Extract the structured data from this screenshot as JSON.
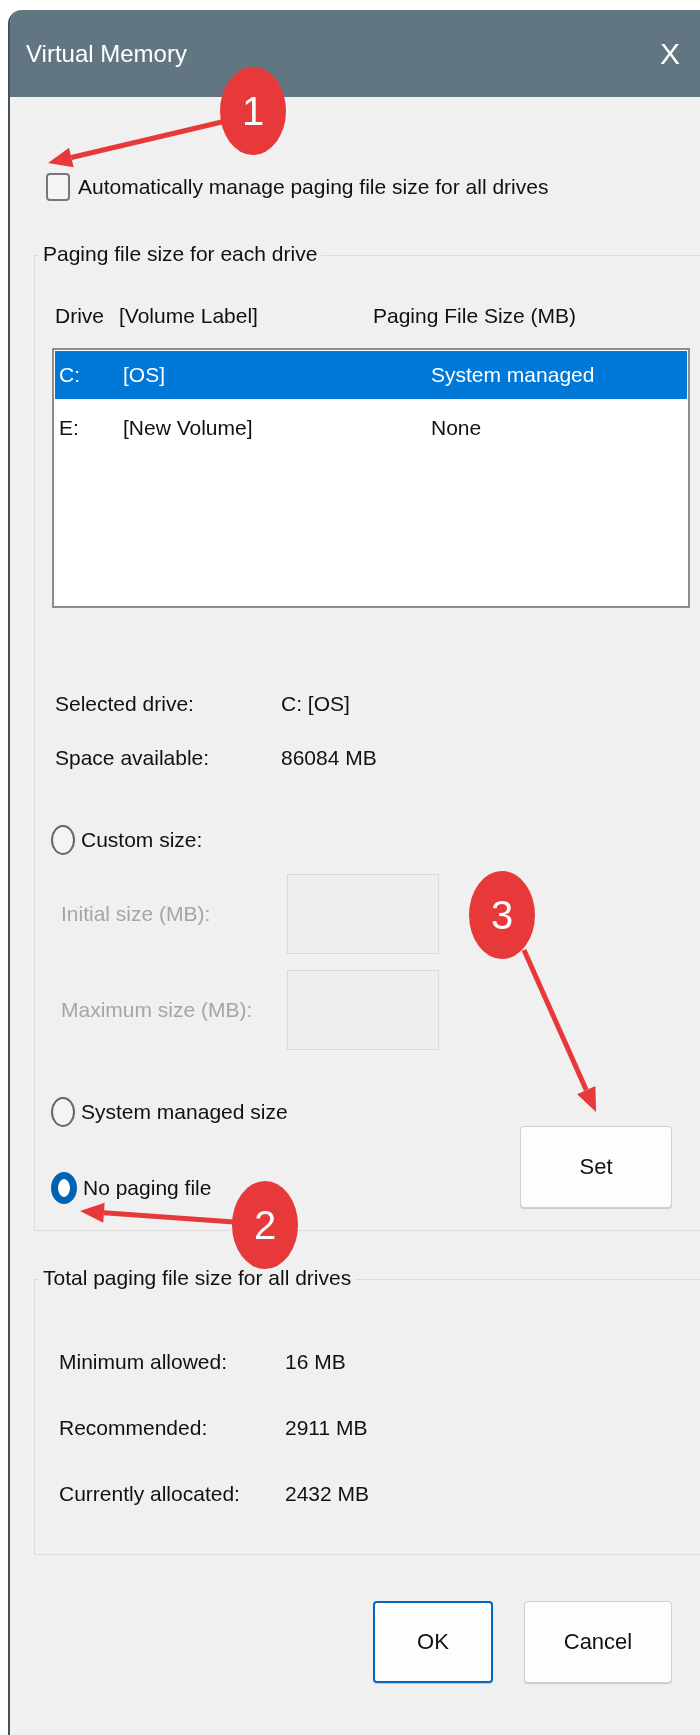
{
  "window": {
    "title": "Virtual Memory",
    "close": "X"
  },
  "auto_manage": {
    "label": "Automatically manage paging file size for all drives",
    "checked": false
  },
  "drive_group": {
    "title": "Paging file size for each drive",
    "columns": [
      "Drive",
      "[Volume Label]",
      "Paging File Size (MB)"
    ],
    "rows": [
      {
        "drive": "C:",
        "volume": "[OS]",
        "size": "System managed",
        "selected": true
      },
      {
        "drive": "E:",
        "volume": "[New Volume]",
        "size": "None",
        "selected": false
      }
    ],
    "info": [
      {
        "label": "Selected drive:",
        "value": "C:  [OS]"
      },
      {
        "label": "Space available:",
        "value": "86084 MB"
      }
    ],
    "size_options": [
      {
        "label": "Custom size:",
        "selected": false
      },
      {
        "label": "System managed size",
        "selected": false
      },
      {
        "label": "No paging file",
        "selected": true
      }
    ],
    "custom_fields": [
      {
        "label": "Initial size (MB):",
        "disabled": true
      },
      {
        "label": "Maximum size (MB):",
        "disabled": true
      }
    ],
    "set_button": "Set"
  },
  "totals_group": {
    "title": "Total paging file size for all drives",
    "rows": [
      {
        "label": "Minimum allowed:",
        "value": "16 MB"
      },
      {
        "label": "Recommended:",
        "value": "2911 MB"
      },
      {
        "label": "Currently allocated:",
        "value": "2432 MB"
      }
    ]
  },
  "buttons": [
    {
      "label": "OK",
      "default": true
    },
    {
      "label": "Cancel",
      "default": false
    }
  ],
  "annotations": [
    {
      "label": "1"
    },
    {
      "label": "2"
    },
    {
      "label": "3"
    }
  ]
}
